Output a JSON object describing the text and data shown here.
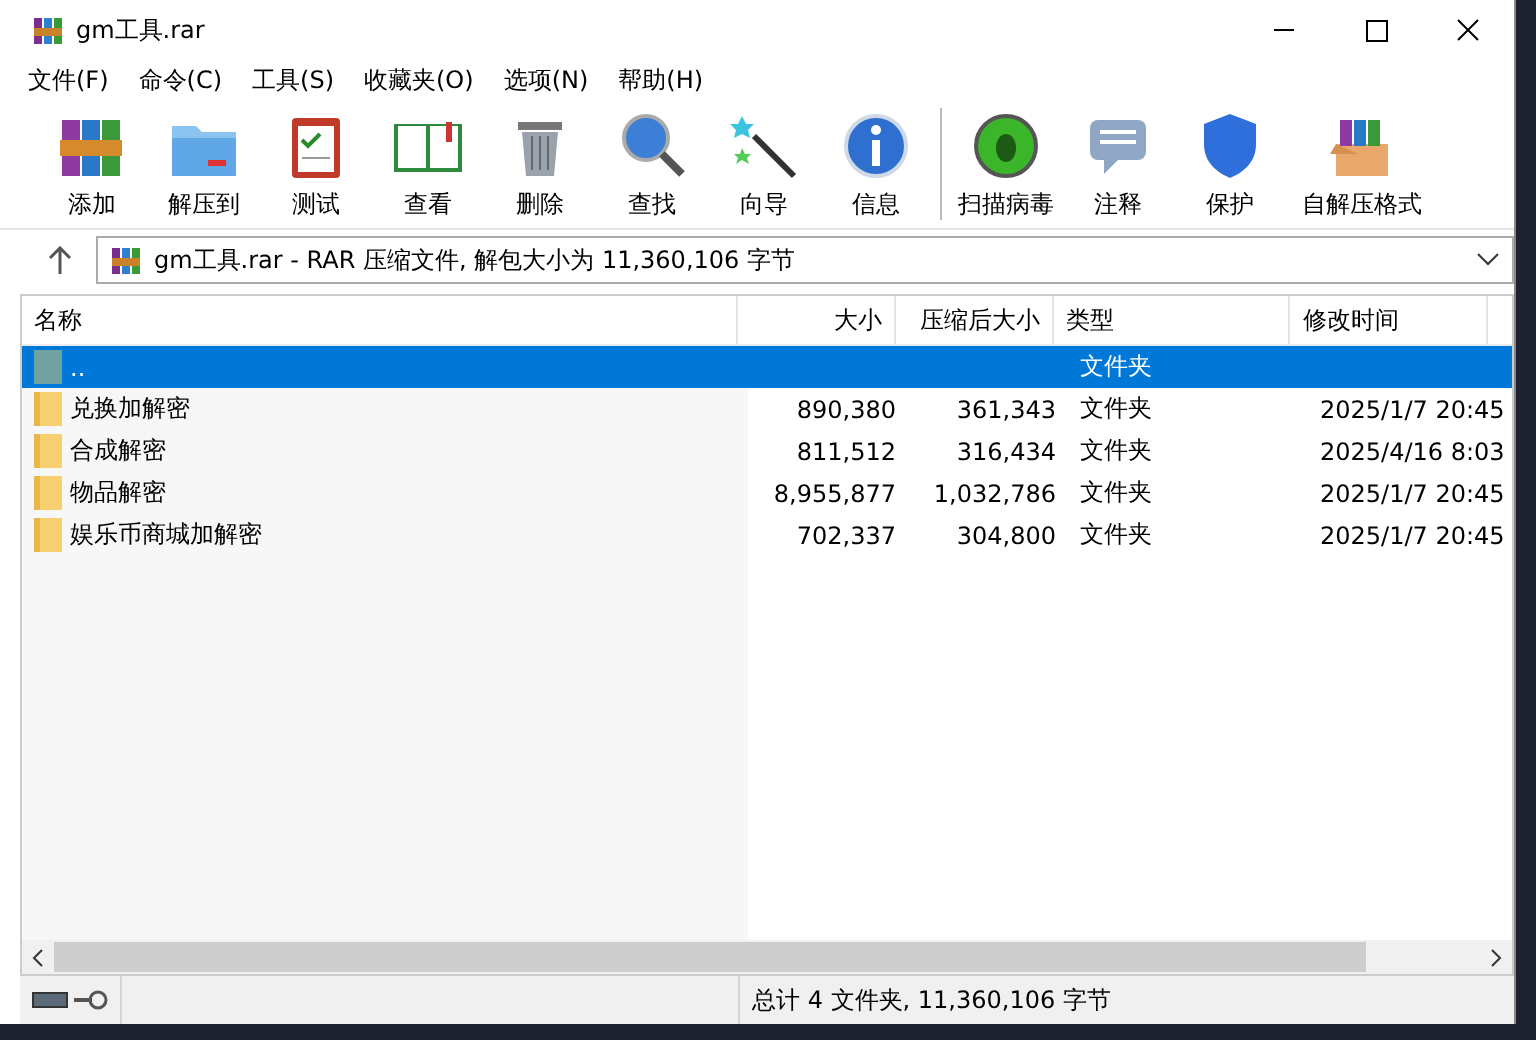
{
  "window": {
    "title": "gm工具.rar"
  },
  "menu": [
    "文件(F)",
    "命令(C)",
    "工具(S)",
    "收藏夹(O)",
    "选项(N)",
    "帮助(H)"
  ],
  "toolbar": [
    {
      "label": "添加",
      "kind": "add"
    },
    {
      "label": "解压到",
      "kind": "extract"
    },
    {
      "label": "测试",
      "kind": "test"
    },
    {
      "label": "查看",
      "kind": "view"
    },
    {
      "label": "删除",
      "kind": "delete"
    },
    {
      "label": "查找",
      "kind": "find"
    },
    {
      "label": "向导",
      "kind": "wizard"
    },
    {
      "label": "信息",
      "kind": "info"
    },
    {
      "label": "扫描病毒",
      "kind": "virus"
    },
    {
      "label": "注释",
      "kind": "comment"
    },
    {
      "label": "保护",
      "kind": "protect"
    },
    {
      "label": "自解压格式",
      "kind": "sfx"
    }
  ],
  "address": "gm工具.rar - RAR 压缩文件, 解包大小为 11,360,106 字节",
  "table": {
    "columns": [
      "名称",
      "大小",
      "压缩后大小",
      "类型",
      "修改时间"
    ],
    "rows": [
      {
        "name": "..",
        "size": "",
        "packed": "",
        "type": "文件夹",
        "modified": "",
        "kind": "up",
        "selected": true
      },
      {
        "name": "兑换加解密",
        "size": "890,380",
        "packed": "361,343",
        "type": "文件夹",
        "modified": "2025/1/7 20:45",
        "kind": "folder",
        "selected": false
      },
      {
        "name": "合成解密",
        "size": "811,512",
        "packed": "316,434",
        "type": "文件夹",
        "modified": "2025/4/16 8:03",
        "kind": "folder",
        "selected": false
      },
      {
        "name": "物品解密",
        "size": "8,955,877",
        "packed": "1,032,786",
        "type": "文件夹",
        "modified": "2025/1/7 20:45",
        "kind": "folder",
        "selected": false
      },
      {
        "name": "娱乐币商城加解密",
        "size": "702,337",
        "packed": "304,800",
        "type": "文件夹",
        "modified": "2025/1/7 20:45",
        "kind": "folder",
        "selected": false
      }
    ]
  },
  "status_bar": "总计 4 文件夹, 11,360,106 字节"
}
